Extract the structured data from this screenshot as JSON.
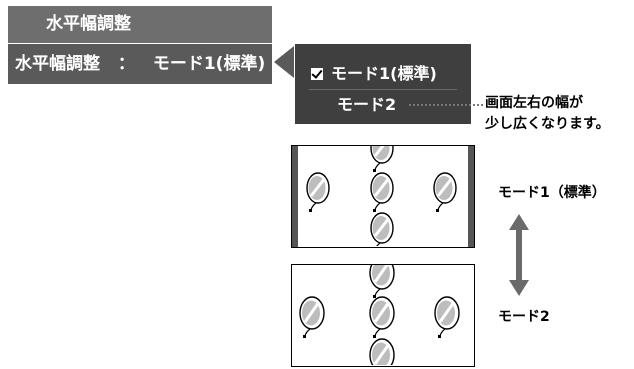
{
  "menu": {
    "title": "水平幅調整",
    "item_label": "水平幅調整",
    "separator": "：",
    "item_value": "モード1(標準)"
  },
  "popup": {
    "options": [
      {
        "label": "モード1(標準)",
        "checked": true
      },
      {
        "label": "モード2",
        "checked": false
      }
    ]
  },
  "annotation": {
    "line1": "画面左右の幅が",
    "line2": "少し広くなります。"
  },
  "diagram": {
    "label_mode1": "モード1（標準）",
    "label_mode2": "モード2"
  },
  "colors": {
    "menu_title_bg": "#6e6e6e",
    "menu_row_bg": "#5a5a5a",
    "popup_bg": "#3f3f3f",
    "bar": "#555555",
    "arrow": "#6a6a6a"
  }
}
